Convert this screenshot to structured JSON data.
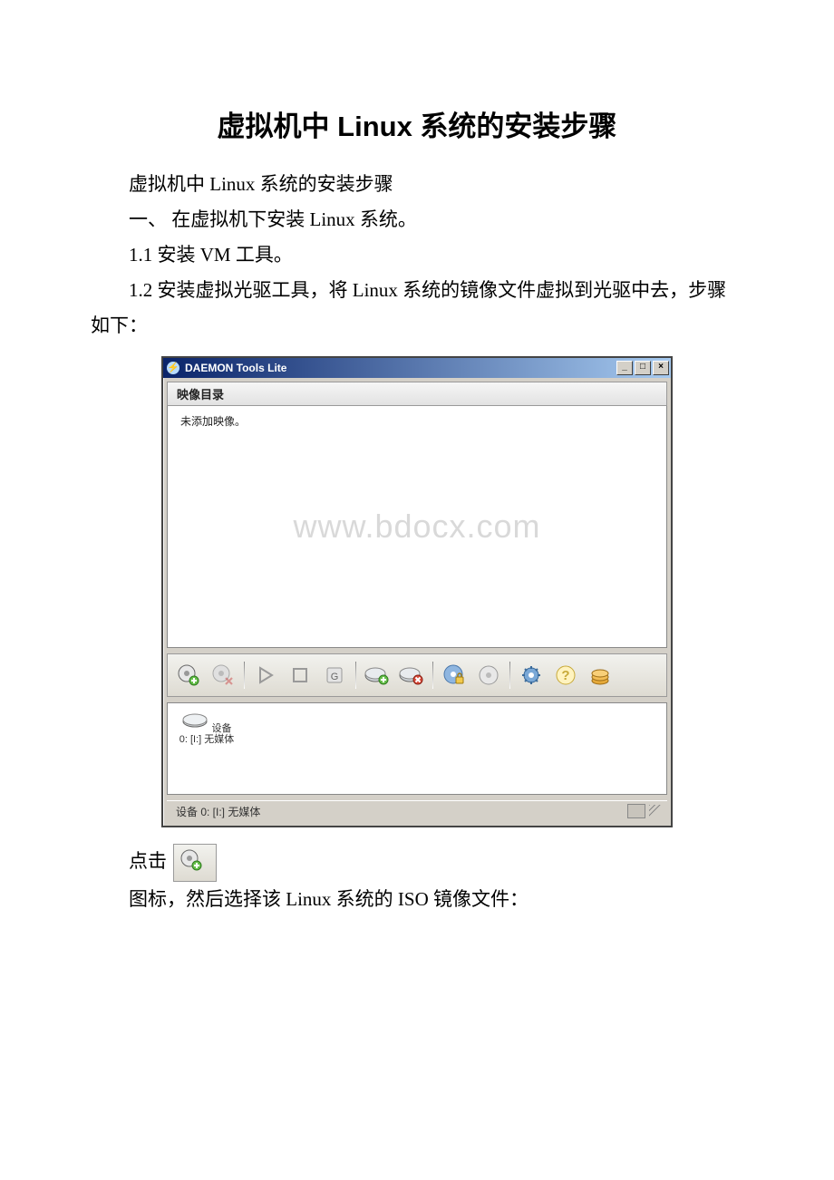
{
  "doc": {
    "title": "虚拟机中 Linux 系统的安装步骤",
    "p1": "虚拟机中 Linux 系统的安装步骤",
    "p2": "一、 在虚拟机下安装 Linux 系统。",
    "p3": "1.1 安装 VM 工具。",
    "p4": "1.2 安装虚拟光驱工具，将 Linux 系统的镜像文件虚拟到光驱中去，步骤如下：",
    "click_label": "点击",
    "p5": "图标，然后选择该 Linux 系统的 ISO 镜像文件："
  },
  "window": {
    "title": "DAEMON Tools Lite",
    "section_header": "映像目录",
    "empty_text": "未添加映像。",
    "device_label": "设备 0: [I:] 无媒体",
    "status": "设备 0: [I:] 无媒体"
  },
  "watermark": "www.bdocx.com",
  "toolbar_icons": [
    "add-image-icon",
    "remove-image-icon",
    "play-icon",
    "stop-icon",
    "mount-region-icon",
    "add-device-icon",
    "remove-device-icon",
    "disc-lock-icon",
    "disc-icon",
    "settings-gear-icon",
    "help-icon",
    "coins-icon"
  ]
}
